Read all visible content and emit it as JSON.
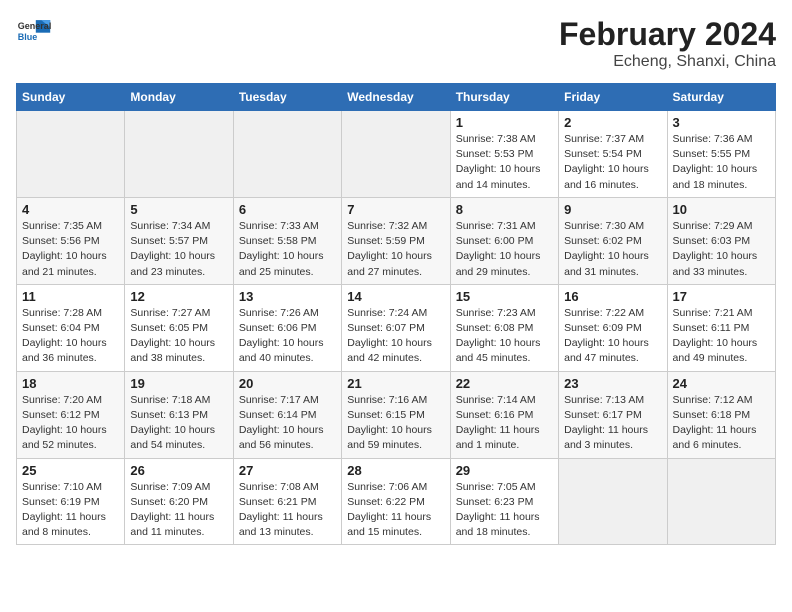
{
  "header": {
    "logo_line1": "General",
    "logo_line2": "Blue",
    "title": "February 2024",
    "subtitle": "Echeng, Shanxi, China"
  },
  "days_of_week": [
    "Sunday",
    "Monday",
    "Tuesday",
    "Wednesday",
    "Thursday",
    "Friday",
    "Saturday"
  ],
  "weeks": [
    [
      {
        "day": "",
        "info": ""
      },
      {
        "day": "",
        "info": ""
      },
      {
        "day": "",
        "info": ""
      },
      {
        "day": "",
        "info": ""
      },
      {
        "day": "1",
        "info": "Sunrise: 7:38 AM\nSunset: 5:53 PM\nDaylight: 10 hours\nand 14 minutes."
      },
      {
        "day": "2",
        "info": "Sunrise: 7:37 AM\nSunset: 5:54 PM\nDaylight: 10 hours\nand 16 minutes."
      },
      {
        "day": "3",
        "info": "Sunrise: 7:36 AM\nSunset: 5:55 PM\nDaylight: 10 hours\nand 18 minutes."
      }
    ],
    [
      {
        "day": "4",
        "info": "Sunrise: 7:35 AM\nSunset: 5:56 PM\nDaylight: 10 hours\nand 21 minutes."
      },
      {
        "day": "5",
        "info": "Sunrise: 7:34 AM\nSunset: 5:57 PM\nDaylight: 10 hours\nand 23 minutes."
      },
      {
        "day": "6",
        "info": "Sunrise: 7:33 AM\nSunset: 5:58 PM\nDaylight: 10 hours\nand 25 minutes."
      },
      {
        "day": "7",
        "info": "Sunrise: 7:32 AM\nSunset: 5:59 PM\nDaylight: 10 hours\nand 27 minutes."
      },
      {
        "day": "8",
        "info": "Sunrise: 7:31 AM\nSunset: 6:00 PM\nDaylight: 10 hours\nand 29 minutes."
      },
      {
        "day": "9",
        "info": "Sunrise: 7:30 AM\nSunset: 6:02 PM\nDaylight: 10 hours\nand 31 minutes."
      },
      {
        "day": "10",
        "info": "Sunrise: 7:29 AM\nSunset: 6:03 PM\nDaylight: 10 hours\nand 33 minutes."
      }
    ],
    [
      {
        "day": "11",
        "info": "Sunrise: 7:28 AM\nSunset: 6:04 PM\nDaylight: 10 hours\nand 36 minutes."
      },
      {
        "day": "12",
        "info": "Sunrise: 7:27 AM\nSunset: 6:05 PM\nDaylight: 10 hours\nand 38 minutes."
      },
      {
        "day": "13",
        "info": "Sunrise: 7:26 AM\nSunset: 6:06 PM\nDaylight: 10 hours\nand 40 minutes."
      },
      {
        "day": "14",
        "info": "Sunrise: 7:24 AM\nSunset: 6:07 PM\nDaylight: 10 hours\nand 42 minutes."
      },
      {
        "day": "15",
        "info": "Sunrise: 7:23 AM\nSunset: 6:08 PM\nDaylight: 10 hours\nand 45 minutes."
      },
      {
        "day": "16",
        "info": "Sunrise: 7:22 AM\nSunset: 6:09 PM\nDaylight: 10 hours\nand 47 minutes."
      },
      {
        "day": "17",
        "info": "Sunrise: 7:21 AM\nSunset: 6:11 PM\nDaylight: 10 hours\nand 49 minutes."
      }
    ],
    [
      {
        "day": "18",
        "info": "Sunrise: 7:20 AM\nSunset: 6:12 PM\nDaylight: 10 hours\nand 52 minutes."
      },
      {
        "day": "19",
        "info": "Sunrise: 7:18 AM\nSunset: 6:13 PM\nDaylight: 10 hours\nand 54 minutes."
      },
      {
        "day": "20",
        "info": "Sunrise: 7:17 AM\nSunset: 6:14 PM\nDaylight: 10 hours\nand 56 minutes."
      },
      {
        "day": "21",
        "info": "Sunrise: 7:16 AM\nSunset: 6:15 PM\nDaylight: 10 hours\nand 59 minutes."
      },
      {
        "day": "22",
        "info": "Sunrise: 7:14 AM\nSunset: 6:16 PM\nDaylight: 11 hours\nand 1 minute."
      },
      {
        "day": "23",
        "info": "Sunrise: 7:13 AM\nSunset: 6:17 PM\nDaylight: 11 hours\nand 3 minutes."
      },
      {
        "day": "24",
        "info": "Sunrise: 7:12 AM\nSunset: 6:18 PM\nDaylight: 11 hours\nand 6 minutes."
      }
    ],
    [
      {
        "day": "25",
        "info": "Sunrise: 7:10 AM\nSunset: 6:19 PM\nDaylight: 11 hours\nand 8 minutes."
      },
      {
        "day": "26",
        "info": "Sunrise: 7:09 AM\nSunset: 6:20 PM\nDaylight: 11 hours\nand 11 minutes."
      },
      {
        "day": "27",
        "info": "Sunrise: 7:08 AM\nSunset: 6:21 PM\nDaylight: 11 hours\nand 13 minutes."
      },
      {
        "day": "28",
        "info": "Sunrise: 7:06 AM\nSunset: 6:22 PM\nDaylight: 11 hours\nand 15 minutes."
      },
      {
        "day": "29",
        "info": "Sunrise: 7:05 AM\nSunset: 6:23 PM\nDaylight: 11 hours\nand 18 minutes."
      },
      {
        "day": "",
        "info": ""
      },
      {
        "day": "",
        "info": ""
      }
    ]
  ]
}
